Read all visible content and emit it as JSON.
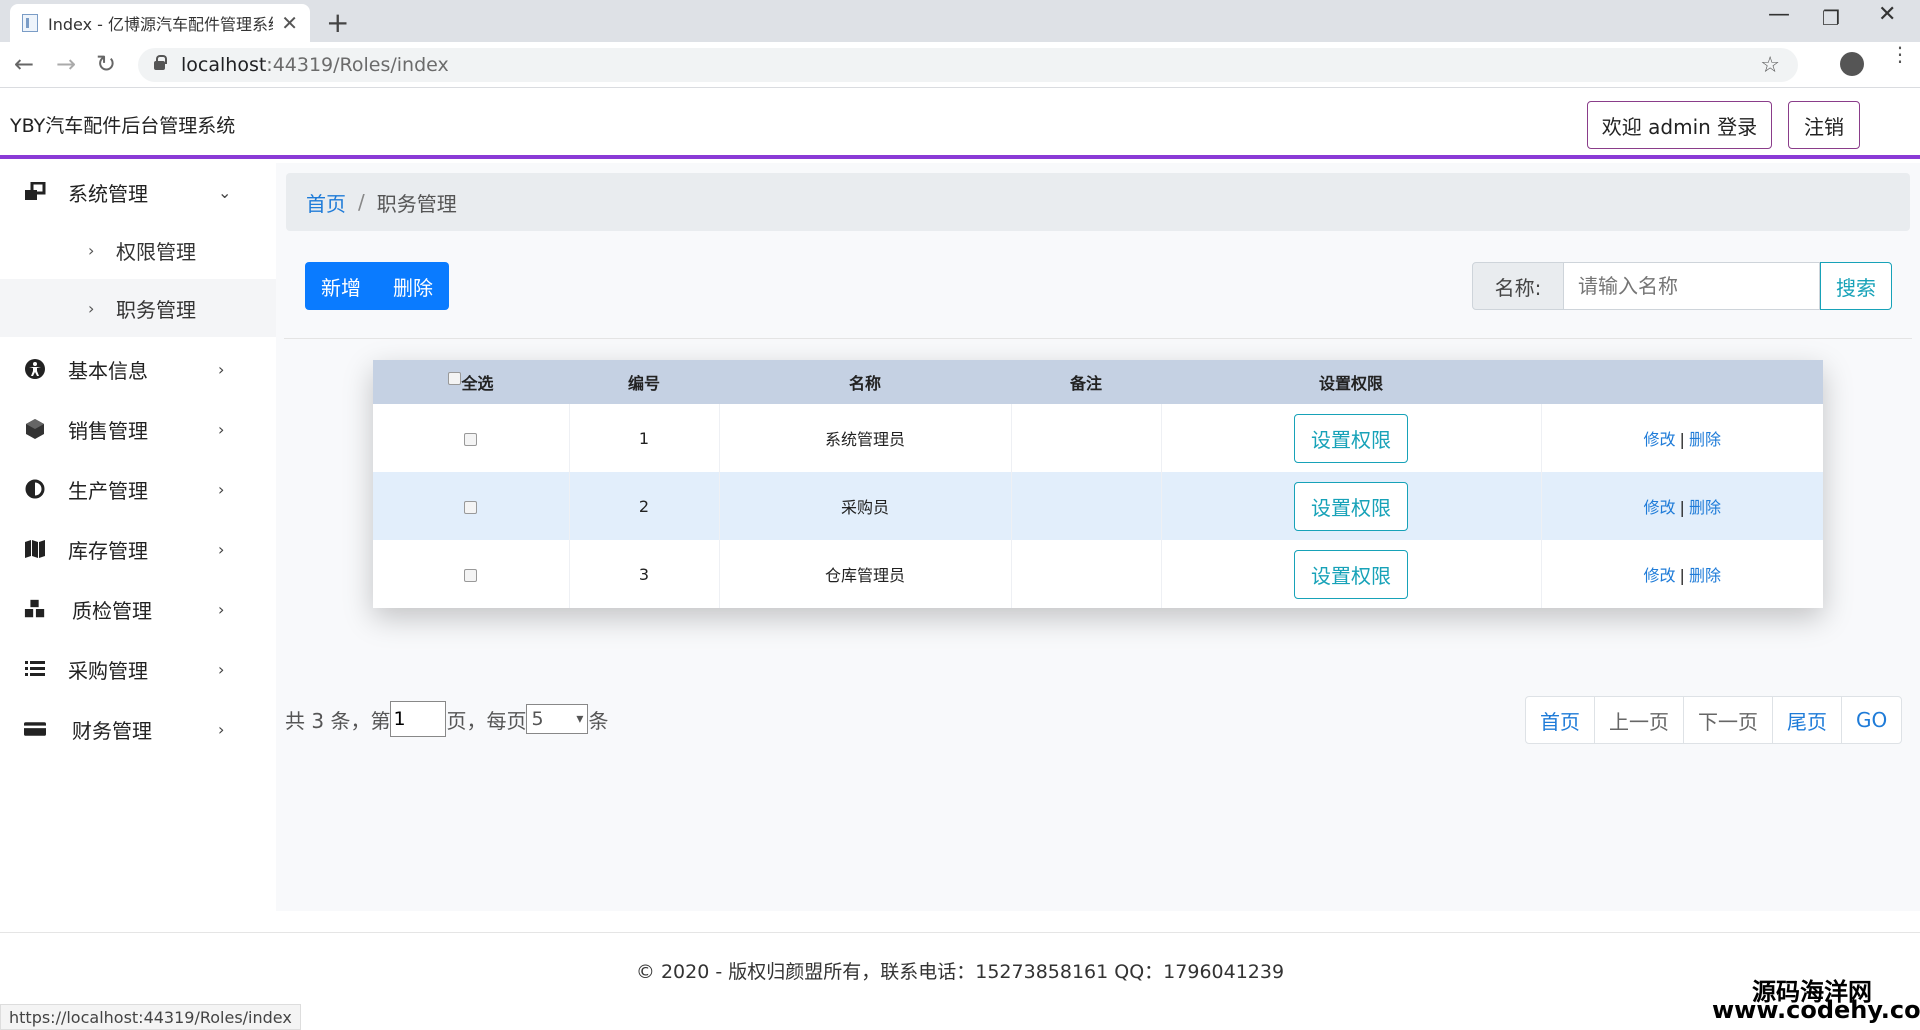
{
  "browser": {
    "tab_title": "Index - 亿博源汽车配件管理系统",
    "close": "✕",
    "newtab": "+",
    "url_host": "localhost",
    "url_path": ":44319/Roles/index",
    "status_url": "https://localhost:44319/Roles/index",
    "minimize": "—",
    "maximize": "❐",
    "winclose": "✕",
    "back": "←",
    "forward": "→",
    "reload": "↻",
    "star": "☆",
    "kebab": "⋮"
  },
  "header": {
    "brand": "YBY汽车配件后台管理系统",
    "welcome": "欢迎 admin 登录",
    "logout": "注销",
    "accent_color": "#8a3ad6"
  },
  "sidebar": {
    "system": {
      "label": "系统管理",
      "icon": "windows-icon"
    },
    "sub": [
      {
        "label": "权限管理"
      },
      {
        "label": "职务管理"
      }
    ],
    "items": [
      {
        "label": "基本信息",
        "icon": "accessibility-icon"
      },
      {
        "label": "销售管理",
        "icon": "cube-icon"
      },
      {
        "label": "生产管理",
        "icon": "contrast-icon"
      },
      {
        "label": "库存管理",
        "icon": "map-icon"
      },
      {
        "label": "质检管理",
        "icon": "cubes-icon"
      },
      {
        "label": "采购管理",
        "icon": "list-icon"
      },
      {
        "label": "财务管理",
        "icon": "credit-card-icon"
      }
    ]
  },
  "breadcrumb": {
    "home": "首页",
    "sep": "/",
    "current": "职务管理"
  },
  "toolbar": {
    "add": "新增",
    "delete": "删除"
  },
  "search": {
    "label": "名称:",
    "placeholder": "请输入名称",
    "button": "搜索"
  },
  "table": {
    "headers": {
      "select_all": "全选",
      "id": "编号",
      "name": "名称",
      "remark": "备注",
      "perm": "设置权限"
    },
    "rows": [
      {
        "id": "1",
        "name": "系统管理员",
        "remark": "",
        "perm": "设置权限",
        "edit": "修改",
        "sep": "|",
        "del": "删除"
      },
      {
        "id": "2",
        "name": "采购员",
        "remark": "",
        "perm": "设置权限",
        "edit": "修改",
        "sep": "|",
        "del": "删除"
      },
      {
        "id": "3",
        "name": "仓库管理员",
        "remark": "",
        "perm": "设置权限",
        "edit": "修改",
        "sep": "|",
        "del": "删除"
      }
    ]
  },
  "pagination": {
    "total_prefix": "共 3 条，第",
    "page_value": "1",
    "per_page_prefix": "页，每页",
    "per_page_value": "5",
    "suffix": "条",
    "first": "首页",
    "prev": "上一页",
    "next": "下一页",
    "last": "尾页",
    "go": "GO"
  },
  "footer": {
    "copyright": "© 2020 - 版权归颜盟所有，联系电话：15273858161 QQ：1796041239"
  },
  "watermark": {
    "line1": "源码海洋网",
    "line2": "www.codehy.com"
  }
}
